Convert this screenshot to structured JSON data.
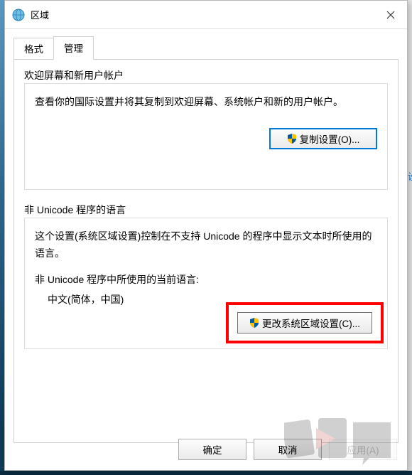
{
  "title": "区域",
  "tabs": {
    "format": "格式",
    "admin": "管理"
  },
  "group1": {
    "title": "欢迎屏幕和新用户帐户",
    "desc": "查看你的国际设置并将其复制到欢迎屏幕、系统帐户和新的用户帐户。",
    "button": "复制设置(O)..."
  },
  "group2": {
    "title": "非 Unicode 程序的语言",
    "desc": "这个设置(系统区域设置)控制在不支持 Unicode 的程序中显示文本时所使用的语言。",
    "subLabel": "非 Unicode 程序中所使用的当前语言:",
    "value": "中文(简体，中国)",
    "button": "更改系统区域设置(C)..."
  },
  "footer": {
    "ok": "确定",
    "cancel": "取消",
    "apply": "应用(A)"
  }
}
